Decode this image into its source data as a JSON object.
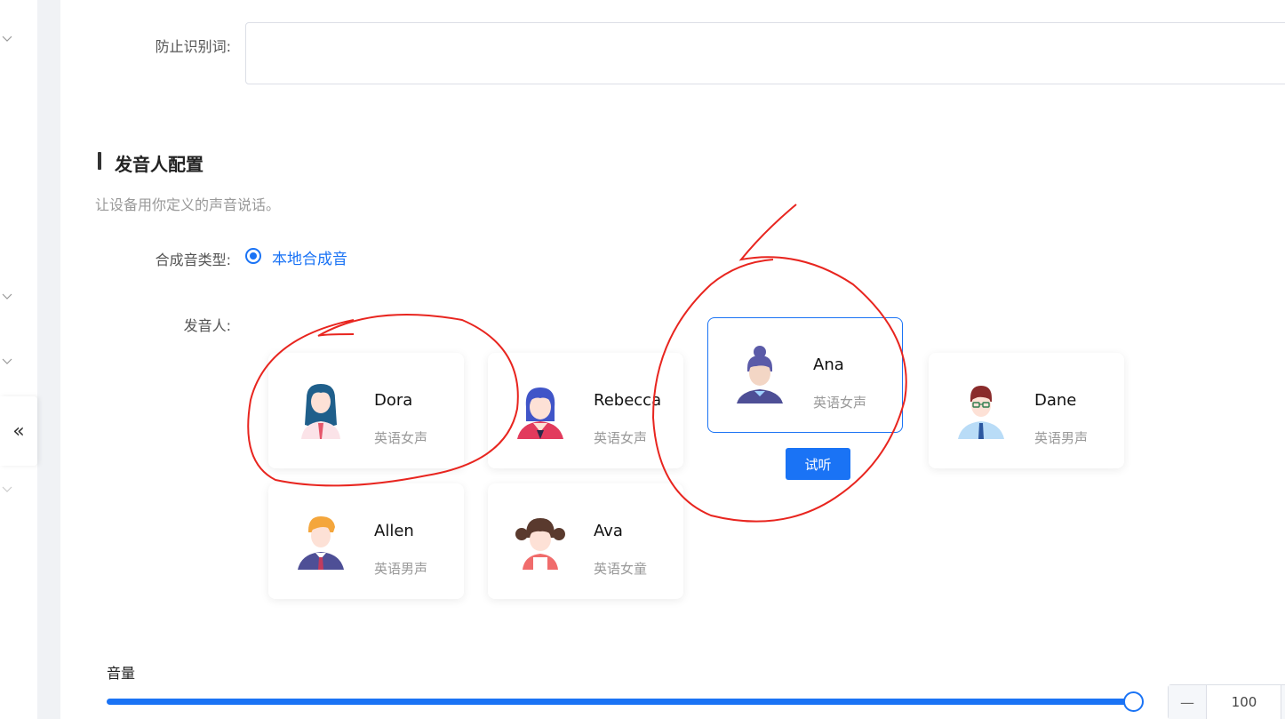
{
  "form": {
    "anti_recognition_label": "防止识别词:",
    "anti_recognition_value": ""
  },
  "speaker_section": {
    "title": "发音人配置",
    "description": "让设备用你定义的声音说话。",
    "synthesis_type_label": "合成音类型:",
    "synthesis_type_option": "本地合成音",
    "speaker_label": "发音人:",
    "try_button": "试听",
    "speakers": [
      {
        "name": "Dora",
        "desc": "英语女声",
        "avatar": "woman-long-hair-avatar",
        "selected": false
      },
      {
        "name": "Rebecca",
        "desc": "英语女声",
        "avatar": "woman-blue-hair-avatar",
        "selected": false
      },
      {
        "name": "Ana",
        "desc": "英语女声",
        "avatar": "woman-bun-avatar",
        "selected": true
      },
      {
        "name": "Dane",
        "desc": "英语男声",
        "avatar": "man-glasses-avatar",
        "selected": false
      },
      {
        "name": "Allen",
        "desc": "英语男声",
        "avatar": "man-orange-hair-avatar",
        "selected": false
      },
      {
        "name": "Ava",
        "desc": "英语女童",
        "avatar": "girl-pigtails-avatar",
        "selected": false
      }
    ]
  },
  "volume": {
    "label": "音量",
    "value": "100",
    "level_percent": 100,
    "minus_symbol": "—"
  },
  "nav": {
    "collapse_symbol": "«"
  },
  "colors": {
    "accent": "#1a73f5",
    "annotation": "#e8251f"
  }
}
